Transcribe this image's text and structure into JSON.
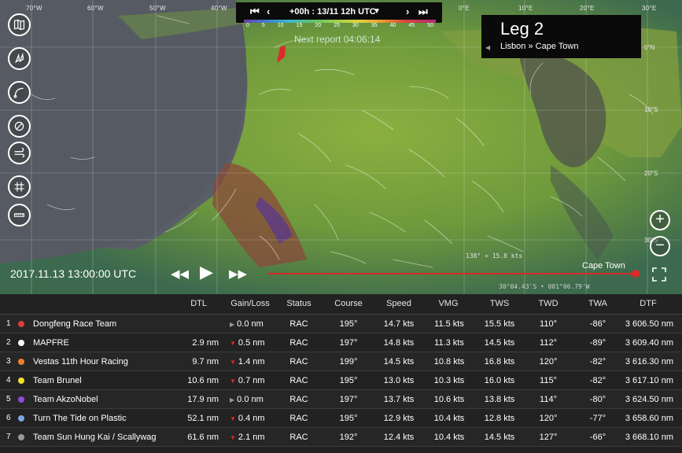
{
  "map": {
    "longitudes": [
      "70°W",
      "60°W",
      "50°W",
      "40°W",
      "0°E",
      "10°E",
      "20°E",
      "30°E"
    ],
    "latitudes": [
      "0°N",
      "10°S",
      "20°S",
      "30°S"
    ],
    "timebar": {
      "first_icon": "skip-first-icon",
      "prev_icon": "chevron-left-icon",
      "time_label": "+00h : 13/11 12h UTC",
      "dropdown_icon": "triangle-down-icon",
      "next_icon": "chevron-right-icon",
      "last_icon": "skip-last-icon"
    },
    "wind_scale": [
      "0",
      "5",
      "10",
      "15",
      "20",
      "25",
      "30",
      "35",
      "40",
      "45",
      "50"
    ],
    "next_report": "Next report 04:06:14",
    "leg": {
      "title": "Leg 2",
      "route": "Lisbon » Cape Town"
    },
    "speed_note": "138° + 15.8 kts",
    "coord_note": "30°04.43'S • 001°06.79'W",
    "destination": "Cape Town",
    "replay_date": "2017.11.13 13:00:00 UTC",
    "tools": [
      "map-book-icon",
      "boats-icon",
      "route-arc-icon",
      "compass-icon",
      "wind-icon",
      "grid-icon",
      "ruler-icon"
    ],
    "zoom": [
      "zoom-in-icon",
      "zoom-out-icon"
    ]
  },
  "table": {
    "headers": [
      "DTL",
      "Gain/Loss",
      "Status",
      "Course",
      "Speed",
      "VMG",
      "TWS",
      "TWD",
      "TWA",
      "DTF"
    ],
    "rows": [
      {
        "rank": "1",
        "team": "Dongfeng Race Team",
        "color": "#e03a3a",
        "dtl": "",
        "gain": "0.0 nm",
        "trend": "flat",
        "status": "RAC",
        "course": "195°",
        "speed": "14.7 kts",
        "vmg": "11.5 kts",
        "tws": "15.5 kts",
        "twd": "110°",
        "twa": "-86°",
        "dtf": "3 606.50 nm"
      },
      {
        "rank": "2",
        "team": "MAPFRE",
        "color": "#ffffff",
        "dtl": "2.9 nm",
        "gain": "0.5 nm",
        "trend": "down",
        "status": "RAC",
        "course": "197°",
        "speed": "14.8 kts",
        "vmg": "11.3 kts",
        "tws": "14.5 kts",
        "twd": "112°",
        "twa": "-89°",
        "dtf": "3 609.40 nm"
      },
      {
        "rank": "3",
        "team": "Vestas 11th Hour Racing",
        "color": "#f07d2a",
        "dtl": "9.7 nm",
        "gain": "1.4 nm",
        "trend": "down",
        "status": "RAC",
        "course": "199°",
        "speed": "14.5 kts",
        "vmg": "10.8 kts",
        "tws": "16.8 kts",
        "twd": "120°",
        "twa": "-82°",
        "dtf": "3 616.30 nm"
      },
      {
        "rank": "4",
        "team": "Team Brunel",
        "color": "#f3e12c",
        "dtl": "10.6 nm",
        "gain": "0.7 nm",
        "trend": "down",
        "status": "RAC",
        "course": "195°",
        "speed": "13.0 kts",
        "vmg": "10.3 kts",
        "tws": "16.0 kts",
        "twd": "115°",
        "twa": "-82°",
        "dtf": "3 617.10 nm"
      },
      {
        "rank": "5",
        "team": "Team AkzoNobel",
        "color": "#8a4fd8",
        "dtl": "17.9 nm",
        "gain": "0.0 nm",
        "trend": "flat",
        "status": "RAC",
        "course": "197°",
        "speed": "13.7 kts",
        "vmg": "10.6 kts",
        "tws": "13.8 kts",
        "twd": "114°",
        "twa": "-80°",
        "dtf": "3 624.50 nm"
      },
      {
        "rank": "6",
        "team": "Turn The Tide on Plastic",
        "color": "#7ea7e0",
        "dtl": "52.1 nm",
        "gain": "0.4 nm",
        "trend": "down",
        "status": "RAC",
        "course": "195°",
        "speed": "12.9 kts",
        "vmg": "10.4 kts",
        "tws": "12.8 kts",
        "twd": "120°",
        "twa": "-77°",
        "dtf": "3 658.60 nm"
      },
      {
        "rank": "7",
        "team": "Team Sun Hung Kai / Scallywag",
        "color": "#9a9a9a",
        "dtl": "61.6 nm",
        "gain": "2.1 nm",
        "trend": "down",
        "status": "RAC",
        "course": "192°",
        "speed": "12.4 kts",
        "vmg": "10.4 kts",
        "tws": "14.5 kts",
        "twd": "127°",
        "twa": "-66°",
        "dtf": "3 668.10 nm"
      }
    ]
  },
  "colors": {
    "accent": "#e02828",
    "trend_down": "#e02828",
    "trend_flat": "#9a9a9a"
  }
}
